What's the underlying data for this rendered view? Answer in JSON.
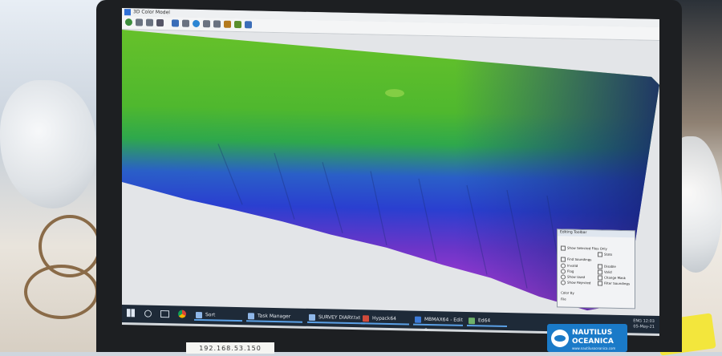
{
  "window": {
    "title": "3D Color Model",
    "controls": "–  □  ×"
  },
  "toolbar": {
    "icons": [
      "globe-icon",
      "palette-icon",
      "layers-icon",
      "fit-icon",
      "path-icon",
      "measure-icon",
      "rotate-icon",
      "select-icon",
      "bucket-icon",
      "pin-icon",
      "tag-icon",
      "edit-icon"
    ]
  },
  "terrain": {
    "colors": {
      "shallow": "#66c12a",
      "mid": "#2ea84c",
      "deep": "#2a3fd0",
      "deeper": "#6a35c8",
      "deepest": "#c03bd8",
      "nodata": "#e3e5e8"
    }
  },
  "dialog": {
    "title": "Editing Toolbar",
    "options": [
      "Show Selected Files Only",
      "Stats",
      "Find Soundings",
      "Invalid",
      "Disable",
      "Flag",
      "Valid",
      "Show Used",
      "Change Mask",
      "Show Rejected",
      "Filter Soundings",
      "Color By"
    ],
    "footer": "File"
  },
  "taskbar": {
    "items": [
      {
        "label": "Sort"
      },
      {
        "label": "Task Manager"
      },
      {
        "label": "SURVEY DIARY.txt -..."
      },
      {
        "label": "Hypack64"
      },
      {
        "label": "MBMAX64 - Edit S..."
      },
      {
        "label": "Ed64"
      }
    ],
    "tray_lang": "ENG",
    "tray_time": "12:03",
    "tray_date": "05-May-21"
  },
  "stickers": {
    "ip": "192.168.53.150",
    "logo_line1": "NAUTILUS",
    "logo_line2": "OCEANICA",
    "logo_line3": "www.nautilusoceanica.com",
    "logo_color": "#1a7ac8"
  }
}
